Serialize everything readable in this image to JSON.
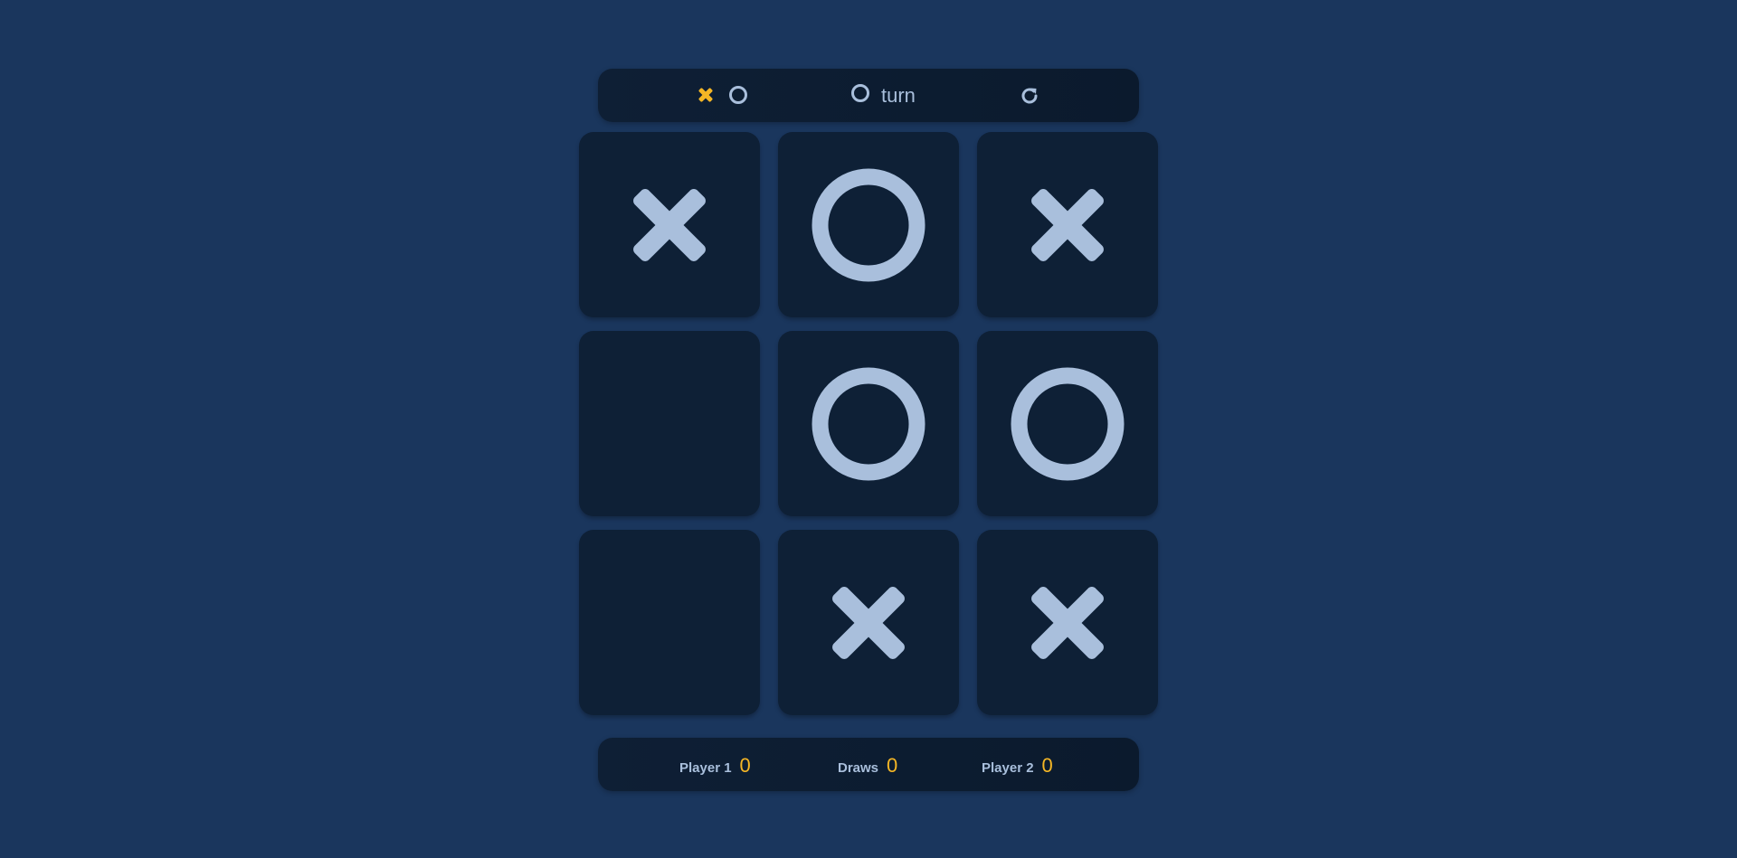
{
  "header": {
    "marks_icons": [
      "x-icon",
      "o-icon"
    ],
    "turn_icon": "o-icon",
    "turn_label": "turn",
    "reset_icon": "refresh-icon"
  },
  "board": {
    "cells": [
      "X",
      "O",
      "X",
      "",
      "O",
      "O",
      "",
      "X",
      "X"
    ]
  },
  "scores": [
    {
      "label": "Player 1",
      "value": "0"
    },
    {
      "label": "Draws",
      "value": "0"
    },
    {
      "label": "Player 2",
      "value": "0"
    }
  ],
  "colors": {
    "background": "#1a365d",
    "cell": "#0e2036",
    "mark": "#a9bfdc",
    "accent": "#f5b625"
  }
}
